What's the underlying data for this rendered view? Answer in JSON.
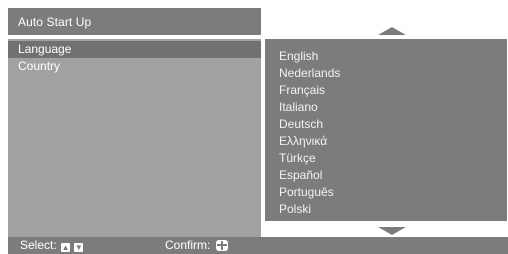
{
  "header": {
    "title": "Auto Start Up"
  },
  "menu": [
    {
      "label": "Language"
    },
    {
      "label": "Country"
    }
  ],
  "languages": [
    {
      "label": "English"
    },
    {
      "label": "Nederlands"
    },
    {
      "label": "Français"
    },
    {
      "label": "Italiano"
    },
    {
      "label": "Deutsch"
    },
    {
      "label": "Ελληνικά"
    },
    {
      "label": "Türkçe"
    },
    {
      "label": "Español"
    },
    {
      "label": "Português"
    },
    {
      "label": "Polski"
    }
  ],
  "footer": {
    "select_label": "Select:",
    "up_key": "▲",
    "down_key": "▼",
    "confirm_label": "Confirm:"
  },
  "icons": {
    "scroll_up": "triangle-up-icon",
    "scroll_down": "triangle-down-icon",
    "confirm_key": "cross-key-icon"
  },
  "colors": {
    "panel_dark": "#7c7c7c",
    "panel_light": "#a1a1a3",
    "highlight": "#717171",
    "text": "#ffffff"
  }
}
